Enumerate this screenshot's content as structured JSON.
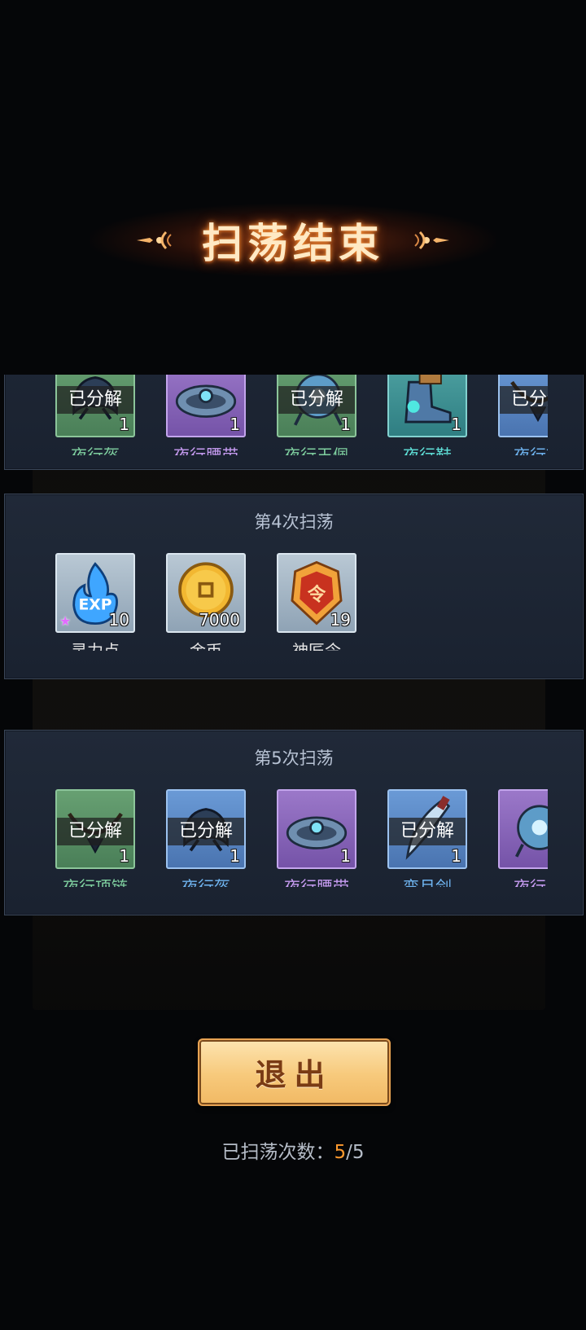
{
  "title": "扫荡结束",
  "sweeps": [
    {
      "label": "",
      "items": [
        {
          "name": "夜行盔",
          "rarity": "green",
          "icon": "helmet-icon",
          "count": "1",
          "decomposed": true,
          "name_color": "#7fd0a0"
        },
        {
          "name": "夜行腰带",
          "rarity": "purple",
          "icon": "belt-icon",
          "count": "1",
          "decomposed": false,
          "name_color": "#c79cf2"
        },
        {
          "name": "夜行玉佩",
          "rarity": "green",
          "icon": "jade-pendant-icon",
          "count": "1",
          "decomposed": true,
          "name_color": "#7fd0a0"
        },
        {
          "name": "夜行鞋",
          "rarity": "teal",
          "icon": "boots-icon",
          "count": "1",
          "decomposed": false,
          "name_color": "#5fe0d8"
        },
        {
          "name": "夜行项",
          "rarity": "blue",
          "icon": "necklace-icon",
          "count": "",
          "decomposed": true,
          "name_color": "#6fb4f0"
        }
      ]
    },
    {
      "label": "第4次扫荡",
      "items": [
        {
          "name": "灵力点",
          "rarity": "gray",
          "icon": "exp-flame-icon",
          "count": "10",
          "decomposed": false,
          "name_color": "#e6e6e6",
          "star": true
        },
        {
          "name": "金币",
          "rarity": "gray",
          "icon": "gold-coin-icon",
          "count": "7000",
          "decomposed": false,
          "name_color": "#e6e6e6"
        },
        {
          "name": "神匠令",
          "rarity": "gray",
          "icon": "craftsman-token-icon",
          "count": "19",
          "decomposed": false,
          "name_color": "#e6e6e6"
        }
      ]
    },
    {
      "label": "第5次扫荡",
      "items": [
        {
          "name": "夜行项链",
          "rarity": "green",
          "icon": "necklace-icon",
          "count": "1",
          "decomposed": true,
          "name_color": "#7fd0a0"
        },
        {
          "name": "夜行盔",
          "rarity": "blue",
          "icon": "helmet-icon",
          "count": "1",
          "decomposed": true,
          "name_color": "#6fb4f0"
        },
        {
          "name": "夜行腰带",
          "rarity": "purple",
          "icon": "belt-icon",
          "count": "1",
          "decomposed": false,
          "name_color": "#c79cf2"
        },
        {
          "name": "弯月剑",
          "rarity": "blue",
          "icon": "crescent-sword-icon",
          "count": "1",
          "decomposed": true,
          "name_color": "#6fb4f0"
        },
        {
          "name": "夜行玉",
          "rarity": "purple",
          "icon": "jade-pendant-icon",
          "count": "",
          "decomposed": false,
          "name_color": "#c79cf2"
        }
      ]
    }
  ],
  "decomposed_label": "已分解",
  "exit_label": "退出",
  "counter": {
    "label": "已扫荡次数：",
    "current": "5",
    "total": "/5"
  },
  "colors": {
    "accent": "#ff9a2e",
    "title_glow": "#c2541a",
    "button": "#f7c97b"
  }
}
